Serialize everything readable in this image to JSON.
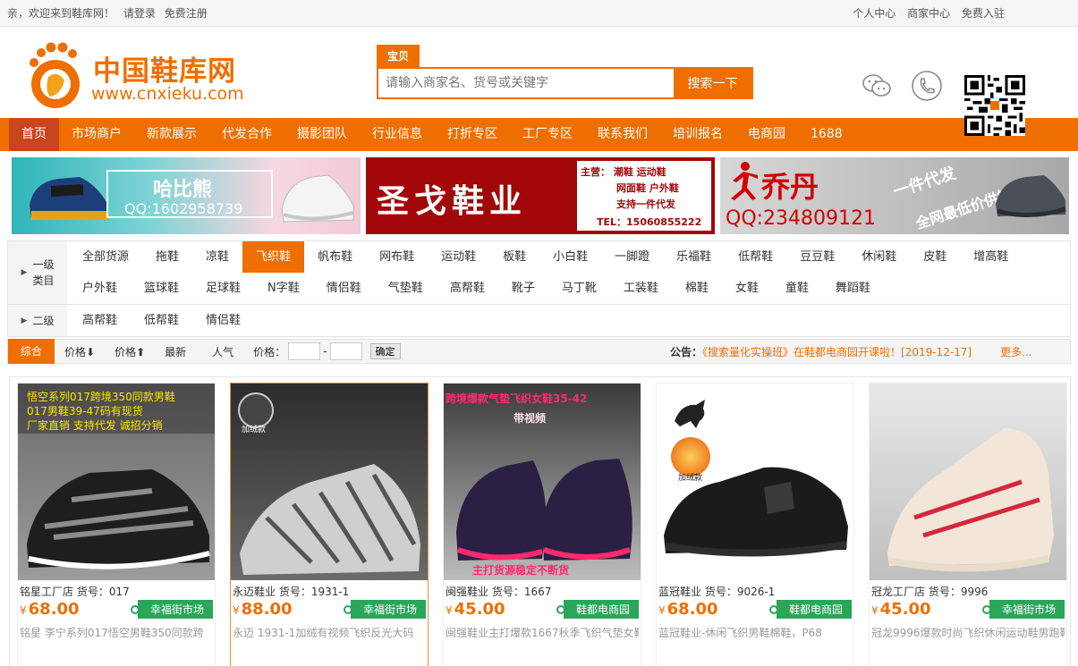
{
  "topbar": {
    "greeting": "亲，欢迎来到鞋库网！",
    "login": "请登录",
    "register": "免费注册",
    "personal": "个人中心",
    "merchant": "商家中心",
    "join": "免费入驻"
  },
  "brand": {
    "name_cn": "中国鞋库网",
    "domain": "www.cnxieku.com",
    "color": "#ee6f00"
  },
  "search": {
    "tab": "宝贝",
    "placeholder": "请输入商家名、货号或关键字",
    "button": "搜索一下"
  },
  "header_icons": [
    "wechat-icon",
    "phone-icon",
    "qr-code"
  ],
  "nav": {
    "items": [
      "首页",
      "市场商户",
      "新款展示",
      "代发合作",
      "摄影团队",
      "行业信息",
      "打折专区",
      "工厂专区",
      "联系我们",
      "培训报名",
      "电商园",
      "1688"
    ]
  },
  "banners": [
    {
      "title": "哈比熊",
      "qq": "QQ:1602958739"
    },
    {
      "title": "圣戈鞋业",
      "line1": "主营：  潮鞋    运动鞋",
      "line2": "网面鞋  户外鞋",
      "line3": "支持一件代发",
      "tel": "TEL：15060855222"
    },
    {
      "title": "乔丹",
      "slogan1": "一件代发",
      "slogan2": "全网最低价供销",
      "qq": "QQ:234809121"
    }
  ],
  "filter": {
    "level1_label": "一级\n类目",
    "level1_items_row1": [
      "全部货源",
      "拖鞋",
      "凉鞋",
      "飞织鞋",
      "帆布鞋",
      "网布鞋",
      "运动鞋",
      "板鞋",
      "小白鞋",
      "一脚蹬",
      "乐福鞋",
      "低帮鞋",
      "豆豆鞋",
      "休闲鞋",
      "皮鞋",
      "增高鞋",
      "户外鞋"
    ],
    "level1_items_row2": [
      "篮球鞋",
      "足球鞋",
      "N字鞋",
      "情侣鞋",
      "气垫鞋",
      "高帮鞋",
      "靴子",
      "马丁靴",
      "工装鞋",
      "棉鞋",
      "女鞋",
      "童鞋",
      "舞蹈鞋"
    ],
    "selected": "飞织鞋",
    "level2_label": "二级",
    "level2_items": [
      "高帮鞋",
      "低帮鞋",
      "情侣鞋"
    ]
  },
  "sort": {
    "overall": "综合",
    "price_down": "价格⬇",
    "price_up": "价格⬆",
    "newest": "最新",
    "popular": "人气",
    "price_label": "价格：",
    "dash": "-",
    "confirm": "确定"
  },
  "notice": {
    "label": "公告：",
    "text": "《搜索量化实操班》在鞋都电商园开课啦！[2019-12-17]",
    "more": "更多..."
  },
  "products": [
    {
      "store": "铭星工厂店 货号：017",
      "currency": "¥",
      "price": "68.00",
      "market": "幸福街市场",
      "desc": "铭星 李宁系列017悟空男鞋350同款跨",
      "img_text": [
        "悟空系列017跨境350同款男鞋",
        "017男鞋39-47码有现货",
        "厂家直销 支持代发 诚招分销"
      ]
    },
    {
      "store": "永迈鞋业 货号：1931-1",
      "currency": "¥",
      "price": "88.00",
      "market": "幸福街市场",
      "desc": "永迈 1931-1加绒有视频飞织反光大码",
      "img_text": [
        "加绒款"
      ]
    },
    {
      "store": "闽强鞋业 货号：1667",
      "currency": "¥",
      "price": "45.00",
      "market": "鞋都电商园",
      "desc": "闽强鞋业主打爆款1667秋季飞织气垫女鞋",
      "img_text": [
        "跨境爆款气垫飞织女鞋35-42",
        "带视频",
        "主打货源稳定不断货"
      ]
    },
    {
      "store": "蓝冠鞋业 货号：9026-1",
      "currency": "¥",
      "price": "68.00",
      "market": "鞋都电商园",
      "desc": "蓝冠鞋业-休闲飞织男鞋棉鞋，P68",
      "img_text": [
        "加绒款"
      ]
    },
    {
      "store": "冠龙工厂店 货号：9996",
      "currency": "¥",
      "price": "45.00",
      "market": "幸福街市场",
      "desc": "冠龙9996爆款时尚飞织休闲运动鞋男跑鞋",
      "img_text": []
    }
  ]
}
